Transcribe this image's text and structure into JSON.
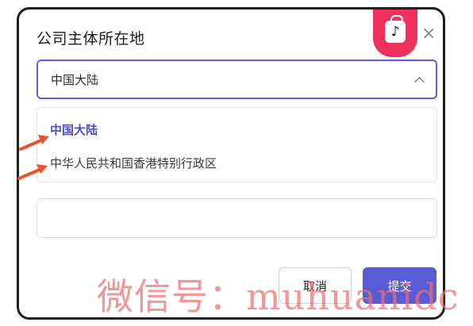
{
  "dialog": {
    "title": "公司主体所在地",
    "close_glyph": "×"
  },
  "brand": {
    "icon": "tiktok-shop-bag-icon",
    "glyph": "♪",
    "color": "#f0315f"
  },
  "select": {
    "value": "中国大陆",
    "expanded": true,
    "border_color": "#5b5fd6",
    "options": [
      {
        "label": "中国大陆",
        "selected": true
      },
      {
        "label": "中华人民共和国香港特别行政区",
        "selected": false
      }
    ]
  },
  "extra_input": {
    "value": "",
    "placeholder": ""
  },
  "actions": {
    "cancel_label": "取消",
    "submit_label": "提交",
    "submit_color": "#5a5cd6"
  },
  "annotations": {
    "arrow_color": "#e8552a",
    "arrow_count": 2
  },
  "watermark": {
    "text": "微信号：muhuanidc"
  }
}
